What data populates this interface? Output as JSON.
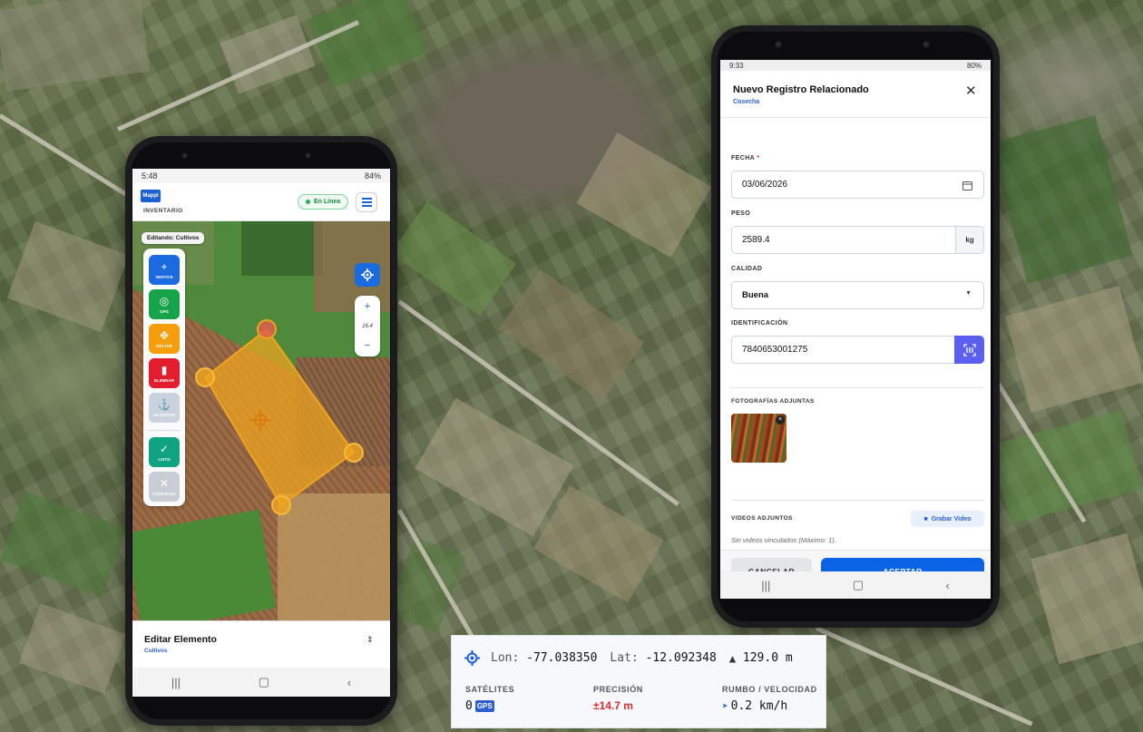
{
  "left_phone": {
    "status_time": "5:48",
    "status_right": "84%",
    "app_logo": "Mappi",
    "app_subtitle": "INVENTARIO",
    "online_label": "En Línea",
    "editing_chip": "Editando: Cultivos",
    "tools": [
      {
        "label": "VERTICE",
        "icon": "plus-icon",
        "color": "#1a6ae0"
      },
      {
        "label": "GPS",
        "icon": "gps-icon",
        "color": "#16a34a"
      },
      {
        "label": "SOLTAR",
        "icon": "move-icon",
        "color": "#f59e0b"
      },
      {
        "label": "ELIMINAR",
        "icon": "trash-icon",
        "color": "#e11d2e"
      },
      {
        "label": "ADJUSTAR",
        "icon": "anchor-icon",
        "color": "#c9d2dd"
      },
      {
        "label": "LISTO",
        "icon": "check-icon",
        "color": "#10a37f"
      },
      {
        "label": "CANCELAR",
        "icon": "close-icon",
        "color": "#c9ced6"
      }
    ],
    "zoom_level": "16.4",
    "bottom_title": "Editar Elemento",
    "bottom_subtitle": "Cultivos"
  },
  "right_phone": {
    "status_time": "9:33",
    "status_right": "80%",
    "title": "Nuevo Registro Relacionado",
    "subtitle": "Cosecha",
    "fields": {
      "fecha_label": "FECHA",
      "fecha_value": "03/06/2026",
      "peso_label": "PESO",
      "peso_value": "2589.4",
      "peso_unit": "kg",
      "calidad_label": "CALIDAD",
      "calidad_value": "Buena",
      "id_label": "IDENTIFICACIÓN",
      "id_value": "7840653001275"
    },
    "photos_label": "FOTOGRAFÍAS ADJUNTAS",
    "videos_label": "VIDEOS ADJUNTOS",
    "record_video": "Grabar Video",
    "no_videos": "Sin videos vinculados (Máximo: 1).",
    "cancel": "CANCELAR",
    "accept": "ACEPTAR"
  },
  "gps": {
    "lon_label": "Lon:",
    "lon": "-77.038350",
    "lat_label": "Lat:",
    "lat": "-12.092348",
    "altitude": "129.0 m",
    "sat_label": "SATÉLITES",
    "sat_value": "0",
    "sat_badge": "GPS",
    "prec_label": "PRECISIÓN",
    "prec_value": "±14.7 m",
    "heading_label": "RUMBO / VELOCIDAD",
    "speed": "0.2 km/h"
  },
  "colors": {
    "primary": "#0b63e6",
    "online": "#1a8a48",
    "polygon": "#f0a51e",
    "precision": "#d32f2f"
  }
}
